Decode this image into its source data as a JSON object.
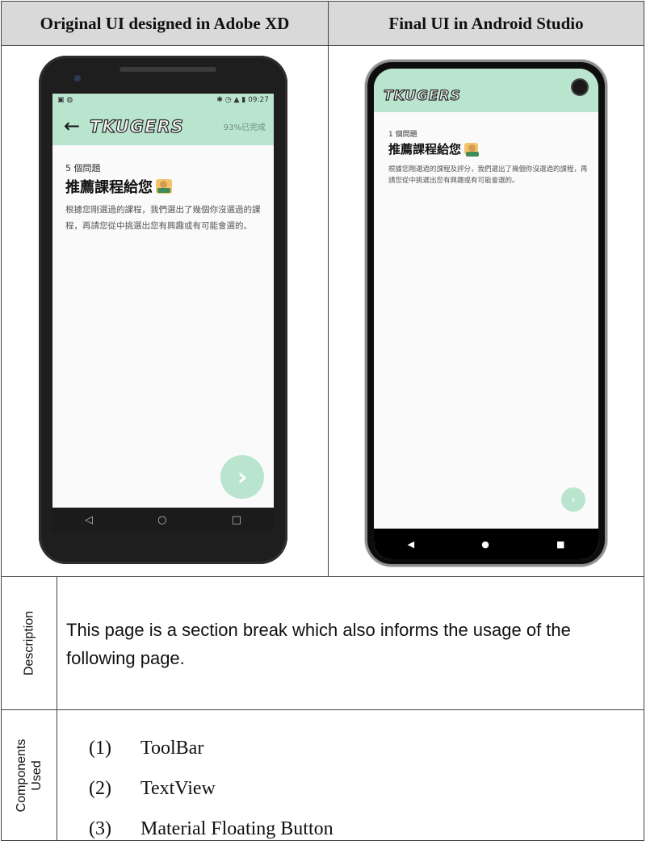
{
  "header": {
    "left_title": "Original UI designed in Adobe XD",
    "right_title": "Final UI in Android Studio"
  },
  "xd_mock": {
    "status_time": "09:27",
    "app_logo": "TKUGERS",
    "progress": "93%已完成",
    "question_count": "5 個問題",
    "title": "推薦課程給您",
    "description": "根據您剛選過的課程，我們選出了幾個你沒選過的課程，再請您從中挑選出您有興趣或有可能會選的。"
  },
  "android_app": {
    "app_logo": "TKUGERS",
    "question_count": "1 個問題",
    "title": "推薦課程給您",
    "description": "根據您剛選過的課程及評分，我們選出了幾個你沒選過的課程，再請您從中挑選出您有興趣或有可能會選的。"
  },
  "description_row": {
    "label": "Description",
    "text": "This page is a section break which also informs the usage of the following page."
  },
  "components_row": {
    "label": "Components Used",
    "items": [
      {
        "num": "(1)",
        "name": "ToolBar"
      },
      {
        "num": "(2)",
        "name": "TextView"
      },
      {
        "num": "(3)",
        "name": "Material Floating Button"
      }
    ]
  },
  "colors": {
    "toolbar_mint": "#b9e5cf",
    "header_gray": "#d9d9d9"
  }
}
